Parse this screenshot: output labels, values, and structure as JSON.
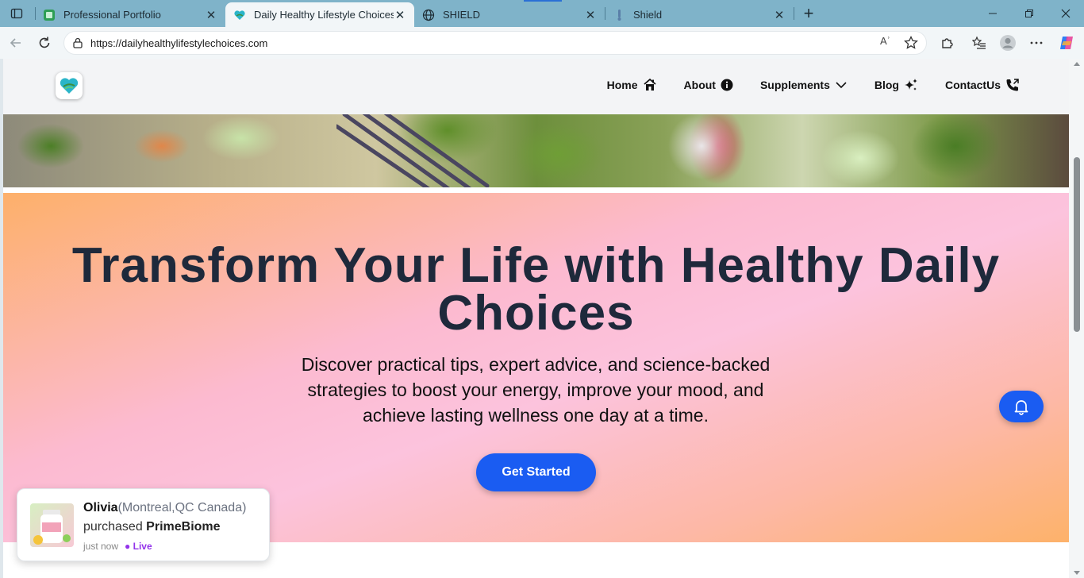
{
  "browser": {
    "tabs": [
      {
        "title": "Professional Portfolio",
        "active": false,
        "icon": "portfolio-favicon"
      },
      {
        "title": "Daily Healthy Lifestyle Choices",
        "active": true,
        "icon": "heart-logo-favicon"
      },
      {
        "title": "SHIELD",
        "active": false,
        "icon": "globe-icon"
      },
      {
        "title": "Shield",
        "active": false,
        "icon": "shield-favicon"
      }
    ],
    "close_glyph": "✕",
    "new_tab_glyph": "+",
    "url": "https://dailyhealthylifestylechoices.com",
    "read_aloud_glyph": "Aʾ"
  },
  "site": {
    "nav": [
      {
        "label": "Home",
        "icon": "home-icon"
      },
      {
        "label": "About",
        "icon": "info-icon"
      },
      {
        "label": "Supplements",
        "icon": "chevron-down-icon"
      },
      {
        "label": "Blog",
        "icon": "sparkles-icon"
      },
      {
        "label": "ContactUs",
        "icon": "phone-icon"
      }
    ],
    "hero": {
      "title": "Transform Your Life with Healthy Daily Choices",
      "subtitle": "Discover practical tips, expert advice, and science-backed strategies to boost your energy, improve your mood, and achieve lasting wellness one day at a time.",
      "cta": "Get Started"
    },
    "toast": {
      "name": "Olivia",
      "location": "(Montreal,QC Canada)",
      "action": "purchased",
      "product": "PrimeBiome",
      "time": "just now",
      "live": "● Live"
    }
  },
  "colors": {
    "accent": "#1a5cf2",
    "heading": "#1e293b",
    "tabstrip": "#7fb3c9",
    "live": "#9333ea"
  }
}
